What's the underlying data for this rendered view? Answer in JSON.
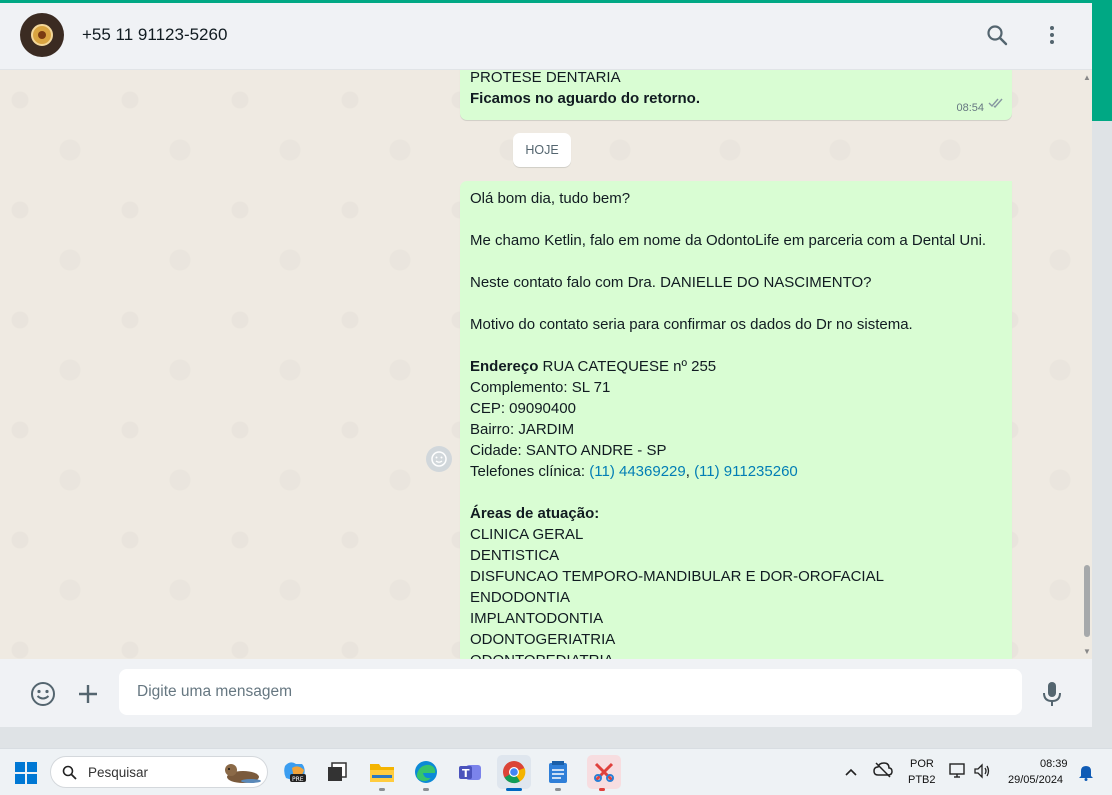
{
  "header": {
    "contact": "+55 11 91123-5260"
  },
  "chat": {
    "previous_message": {
      "lines": [
        "PROTESE DENTARIA",
        "Ficamos no aguardo do retorno."
      ],
      "time": "08:54"
    },
    "date_separator": "HOJE",
    "message": {
      "greeting": "Olá bom dia, tudo bem?",
      "intro": "Me chamo Ketlin, falo em nome da OdontoLife em parceria com a Dental Uni.",
      "question": "Neste contato falo com Dra. DANIELLE DO NASCIMENTO?",
      "reason": "Motivo do contato seria para confirmar os dados do Dr no sistema.",
      "address_label": "Endereço",
      "address_value": "RUA CATEQUESE nº 255",
      "complement": "Complemento: SL 71",
      "cep": "CEP: 09090400",
      "neighborhood": "Bairro: JARDIM",
      "city": "Cidade: SANTO ANDRE - SP",
      "phones_label": "Telefones clínica:",
      "phone1": "(11) 44369229",
      "phone_sep": ",",
      "phone2": "(11) 911235260",
      "areas_title": "Áreas de atuação:",
      "areas": [
        "CLINICA GERAL",
        "DENTISTICA",
        "DISFUNCAO TEMPORO-MANDIBULAR E DOR-OROFACIAL",
        "ENDODONTIA",
        "IMPLANTODONTIA",
        "ODONTOGERIATRIA",
        "ODONTOPEDIATRIA"
      ]
    }
  },
  "composer": {
    "placeholder": "Digite uma mensagem"
  },
  "taskbar": {
    "search_placeholder": "Pesquisar",
    "lang_top": "POR",
    "lang_bottom": "PTB2",
    "time": "08:39",
    "date": "29/05/2024"
  },
  "colors": {
    "accent": "#00a884",
    "outgoing_bubble": "#d9fdd3",
    "link": "#027eb5"
  }
}
